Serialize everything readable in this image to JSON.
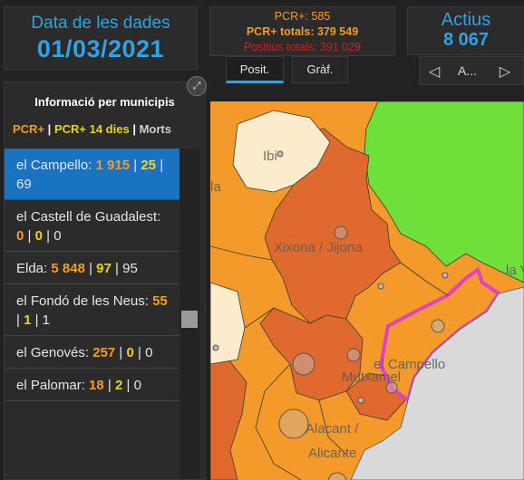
{
  "date": {
    "label": "Data de les dades",
    "value": "01/03/2021"
  },
  "pcr": {
    "line1": "PCR+: 585",
    "line2": "PCR+ totals: 379 549",
    "line3": "Positius totals: 391 029"
  },
  "tabs": [
    {
      "label": "Posit."
    },
    {
      "label": "Gràf."
    }
  ],
  "actius": {
    "label": "Actius",
    "value": "8 067"
  },
  "pager": {
    "prev_icon": "chevron-left-icon",
    "text": "A...",
    "next_icon": "chevron-right-icon"
  },
  "list": {
    "title": "Informació per municipis",
    "legend": {
      "pcr": "PCR+",
      "pcr14": "PCR+ 14 dies",
      "morts": "Morts",
      "sep": "|"
    },
    "items": [
      {
        "name": "el Campello:",
        "pcr": "1 915",
        "pcr14": "25",
        "morts": "69",
        "selected": true
      },
      {
        "name": "el Castell de Guadalest:",
        "pcr": "0",
        "pcr14": "0",
        "morts": "0"
      },
      {
        "name": "Elda:",
        "pcr": "5 848",
        "pcr14": "97",
        "morts": "95"
      },
      {
        "name": "el Fondó de les Neus:",
        "pcr": "55",
        "pcr14": "1",
        "morts": "1"
      },
      {
        "name": "el Genovés:",
        "pcr": "257",
        "pcr14": "0",
        "morts": "0"
      },
      {
        "name": "el Palomar:",
        "pcr": "18",
        "pcr14": "2",
        "morts": "0"
      }
    ]
  },
  "map": {
    "labels": {
      "ibi": "Ibi",
      "xixona": "Xixona / Jijona",
      "campello": "el Campello",
      "mutxamel": "Mutxamel",
      "alacant": "Alacant /",
      "alicante": "Alicante",
      "vila": "la V",
      "edge": "la"
    },
    "colors": {
      "green": "#6fe03a",
      "orange": "#f39a2b",
      "dark_orange": "#e06a2e",
      "light": "#fdeccb",
      "sea": "#d9d9d9",
      "highlight": "#e040c8"
    }
  },
  "colors": {
    "accent": "#2fa3e6",
    "selected": "#1a73c0",
    "pcr": "#f59b2a",
    "pcr14": "#e8d51a",
    "total_positius": "#d21f1f"
  }
}
